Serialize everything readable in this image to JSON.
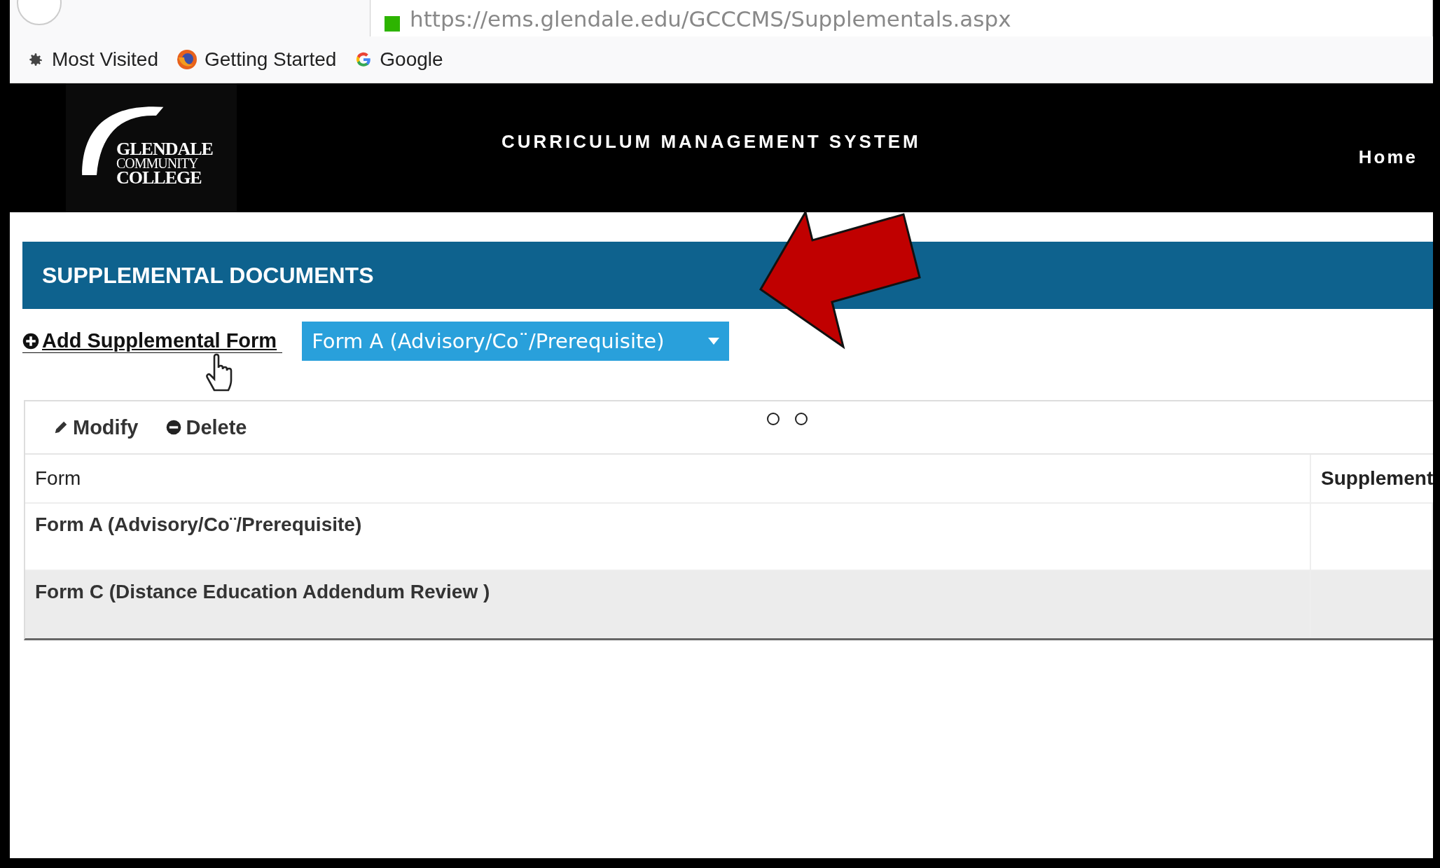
{
  "browser": {
    "url": "https://ems.glendale.edu/GCCCMS/Supplementals.aspx",
    "bookmarks": [
      {
        "label": "Most Visited",
        "kind": "gear"
      },
      {
        "label": "Getting Started",
        "kind": "firefox"
      },
      {
        "label": "Google",
        "kind": "google"
      }
    ]
  },
  "header": {
    "logo": [
      "GLENDALE",
      "COMMUNITY",
      "COLLEGE"
    ],
    "title": "CURRICULUM MANAGEMENT SYSTEM",
    "nav": [
      "Home"
    ]
  },
  "section": {
    "title": "SUPPLEMENTAL DOCUMENTS",
    "add_link": "Add Supplemental Form",
    "form_select": {
      "value": "Form A (Advisory/Co¨/Prerequisite)"
    }
  },
  "table": {
    "toolbar": [
      {
        "label": "Modify",
        "kind": "edit"
      },
      {
        "label": "Delete",
        "kind": "delete"
      }
    ],
    "columns": [
      "Form",
      "Supplement"
    ],
    "rows": [
      {
        "cells": [
          "Form A (Advisory/Co¨/Prerequisite)",
          ""
        ]
      },
      {
        "cells": [
          "Form C (Distance Education Addendum Review )",
          ""
        ]
      }
    ]
  }
}
